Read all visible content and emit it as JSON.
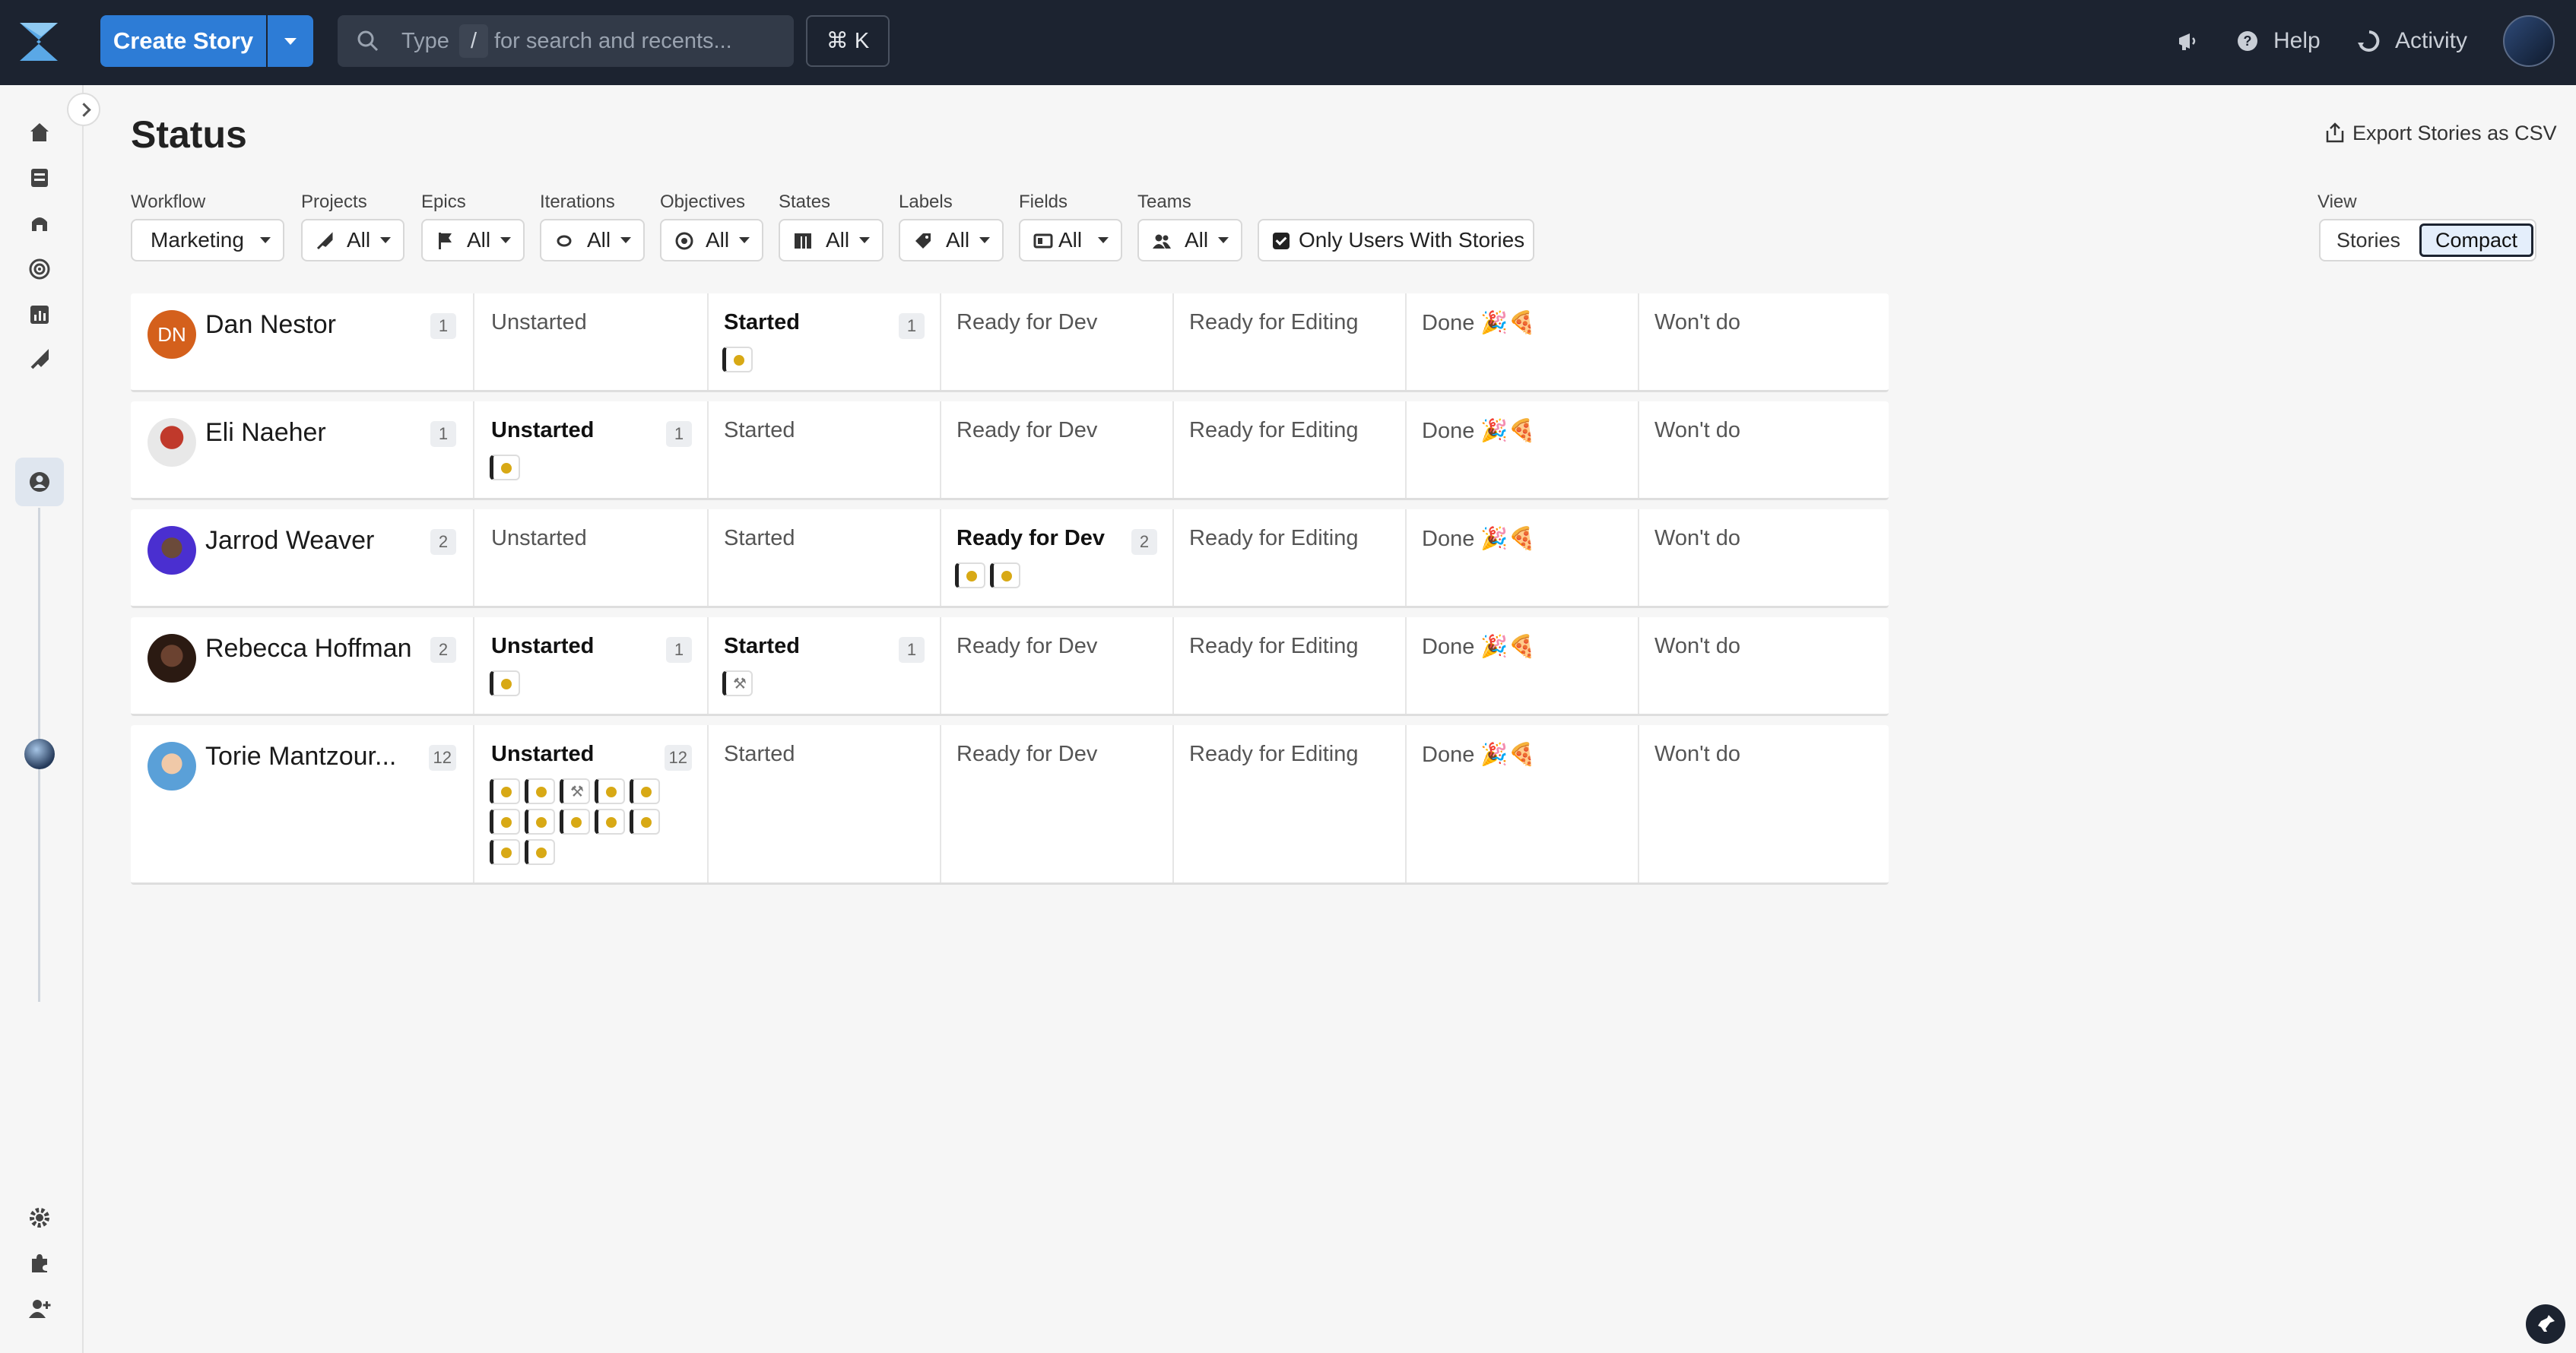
{
  "topbar": {
    "create_label": "Create Story",
    "search_placeholder_1": "Type",
    "search_slash": "/",
    "search_placeholder_2": "for search and recents...",
    "shortcut": "⌘ K",
    "help_label": "Help",
    "activity_label": "Activity"
  },
  "page": {
    "title": "Status",
    "export_label": "Export Stories as CSV"
  },
  "filters": {
    "workflow": {
      "label": "Workflow",
      "value": "Marketing"
    },
    "projects": {
      "label": "Projects",
      "value": "All"
    },
    "epics": {
      "label": "Epics",
      "value": "All"
    },
    "iterations": {
      "label": "Iterations",
      "value": "All"
    },
    "objectives": {
      "label": "Objectives",
      "value": "All"
    },
    "states": {
      "label": "States",
      "value": "All"
    },
    "labels": {
      "label": "Labels",
      "value": "All"
    },
    "fields": {
      "label": "Fields",
      "value": "All"
    },
    "teams": {
      "label": "Teams",
      "value": "All"
    },
    "only_users": "Only Users With Stories"
  },
  "view": {
    "label": "View",
    "options": [
      "Stories",
      "Compact"
    ],
    "selected": "Compact"
  },
  "rows": [
    {
      "name": "Dan Nestor",
      "initials": "DN",
      "count": "1",
      "cells": [
        {
          "label": "Unstarted"
        },
        {
          "label": "Started",
          "count": "1"
        },
        {
          "label": "Ready for Dev"
        },
        {
          "label": "Ready for Editing"
        },
        {
          "label": "Done 🎉🍕"
        },
        {
          "label": "Won't do"
        }
      ]
    },
    {
      "name": "Eli Naeher",
      "count": "1",
      "cells": [
        {
          "label": "Unstarted",
          "count": "1"
        },
        {
          "label": "Started"
        },
        {
          "label": "Ready for Dev"
        },
        {
          "label": "Ready for Editing"
        },
        {
          "label": "Done 🎉🍕"
        },
        {
          "label": "Won't do"
        }
      ]
    },
    {
      "name": "Jarrod Weaver",
      "count": "2",
      "cells": [
        {
          "label": "Unstarted"
        },
        {
          "label": "Started"
        },
        {
          "label": "Ready for Dev",
          "count": "2"
        },
        {
          "label": "Ready for Editing"
        },
        {
          "label": "Done 🎉🍕"
        },
        {
          "label": "Won't do"
        }
      ]
    },
    {
      "name": "Rebecca Hoffman",
      "count": "2",
      "cells": [
        {
          "label": "Unstarted",
          "count": "1"
        },
        {
          "label": "Started",
          "count": "1"
        },
        {
          "label": "Ready for Dev"
        },
        {
          "label": "Ready for Editing"
        },
        {
          "label": "Done 🎉🍕"
        },
        {
          "label": "Won't do"
        }
      ]
    },
    {
      "name": "Torie Mantzour...",
      "count": "12",
      "cells": [
        {
          "label": "Unstarted",
          "count": "12"
        },
        {
          "label": "Started"
        },
        {
          "label": "Ready for Dev"
        },
        {
          "label": "Ready for Editing"
        },
        {
          "label": "Done 🎉🍕"
        },
        {
          "label": "Won't do"
        }
      ]
    }
  ],
  "colors": {
    "topbar": "#1c2330",
    "primary": "#2d7cd6",
    "feature_dot": "#d8a915",
    "dan_avatar": "#d4601c"
  }
}
